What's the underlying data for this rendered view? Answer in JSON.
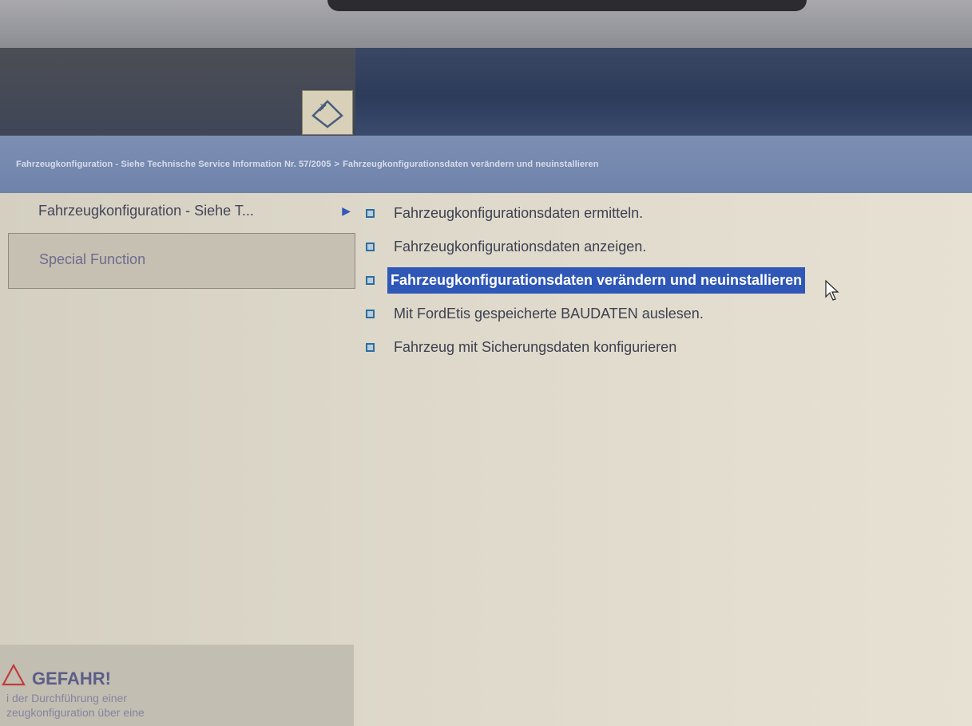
{
  "breadcrumb": {
    "parts": [
      "Fahrzeugkonfiguration - Siehe Technische Service Information Nr. 57/2005",
      "Fahrzeugkonfigurationsdaten verändern und neuinstallieren"
    ],
    "separator": ">"
  },
  "sidebar": {
    "items": [
      {
        "label": "Fahrzeugkonfiguration - Siehe T...",
        "arrow": "▶"
      },
      {
        "label": "Special Function"
      }
    ]
  },
  "menu": {
    "items": [
      {
        "label": "Fahrzeugkonfigurationsdaten ermitteln."
      },
      {
        "label": "Fahrzeugkonfigurationsdaten anzeigen."
      },
      {
        "label": "Fahrzeugkonfigurationsdaten verändern und neuinstallieren",
        "selected": true
      },
      {
        "label": "Mit FordEtis gespeicherte BAUDATEN auslesen."
      },
      {
        "label": "Fahrzeug mit Sicherungsdaten konfigurieren"
      }
    ]
  },
  "warning": {
    "title": "GEFAHR!",
    "lines": [
      "i der Durchführung einer",
      "zeugkonfiguration über eine"
    ]
  },
  "colors": {
    "toolbar": "#2d3b5b",
    "breadcrumb_bar": "#6f83ab",
    "selection": "#2f57b8",
    "warning_title": "#5c5e88"
  },
  "icons": [
    "app-logo-icon",
    "menu-bullet-icon",
    "chevron-right-icon",
    "warning-triangle-icon",
    "mouse-pointer-icon"
  ]
}
